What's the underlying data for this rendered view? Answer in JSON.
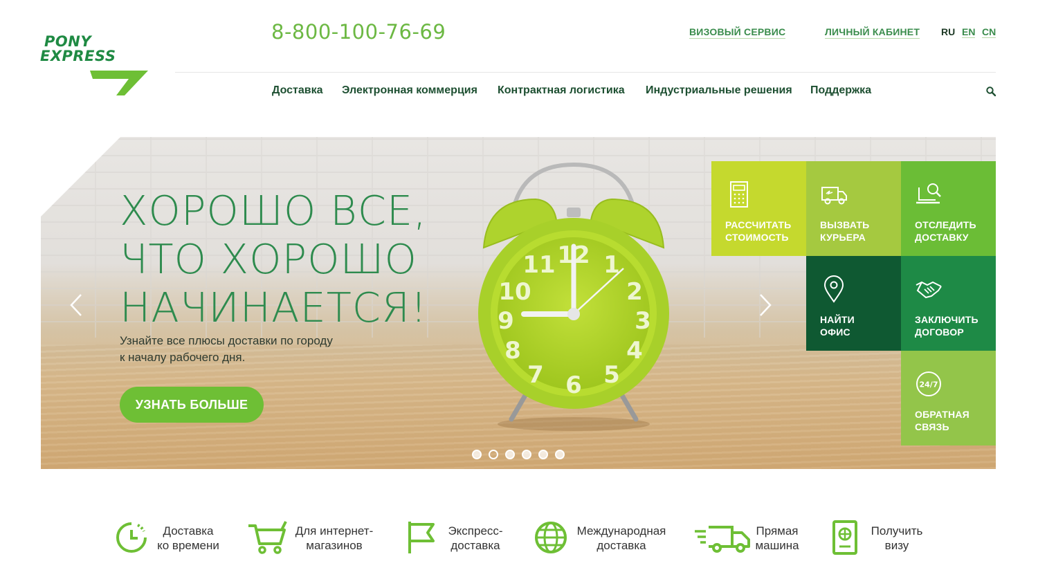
{
  "logo": {
    "line1": "PONY",
    "line2": "EXPRESS"
  },
  "header": {
    "phone": "8-800-100-76-69",
    "visa_service": "ВИЗОВЫЙ СЕРВИС",
    "personal_account": "ЛИЧНЫЙ КАБИНЕТ",
    "languages": [
      "RU",
      "EN",
      "CN"
    ],
    "active_language": "RU"
  },
  "nav": {
    "items": [
      "Доставка",
      "Электронная коммерция",
      "Контрактная логистика",
      "Индустриальные решения",
      "Поддержка"
    ]
  },
  "hero": {
    "title_lines": [
      "ХОРОШО ВСЕ,",
      "ЧТО ХОРОШО",
      "НАЧИНАЕТСЯ!"
    ],
    "subtitle_lines": [
      "Узнайте все плюсы доставки по городу",
      "к началу рабочего дня."
    ],
    "button": "УЗНАТЬ БОЛЬШЕ",
    "slide_count": 6,
    "active_slide": 2
  },
  "tiles": [
    {
      "line1": "РАССЧИТАТЬ",
      "line2": "СТОИМОСТЬ",
      "icon": "calculator-icon",
      "color": "#c5d92e"
    },
    {
      "line1": "ВЫЗВАТЬ",
      "line2": "КУРЬЕРА",
      "icon": "truck-icon",
      "color": "#a5c940"
    },
    {
      "line1": "ОТСЛЕДИТЬ",
      "line2": "ДОСТАВКУ",
      "icon": "laptop-search-icon",
      "color": "#6bbd36"
    },
    {
      "line1": "НАЙТИ",
      "line2": "ОФИС",
      "icon": "location-pin-icon",
      "color": "#0f5932"
    },
    {
      "line1": "ЗАКЛЮЧИТЬ",
      "line2": "ДОГОВОР",
      "icon": "handshake-icon",
      "color": "#1e8a46"
    },
    {
      "line1": "ОБРАТНАЯ",
      "line2": "СВЯЗЬ",
      "icon": "support-24-7-icon",
      "color": "#93c54a"
    }
  ],
  "features": [
    {
      "line1": "Доставка",
      "line2": "ко времени",
      "icon": "clock-icon"
    },
    {
      "line1": "Для интернет-",
      "line2": "магазинов",
      "icon": "cart-icon"
    },
    {
      "line1": "Экспресс-",
      "line2": "доставка",
      "icon": "flag-icon"
    },
    {
      "line1": "Международная",
      "line2": "доставка",
      "icon": "globe-icon"
    },
    {
      "line1": "Прямая",
      "line2": "машина",
      "icon": "fast-truck-icon"
    },
    {
      "line1": "Получить",
      "line2": "визу",
      "icon": "passport-icon"
    }
  ],
  "colors": {
    "brand_green": "#6ebf35",
    "dark_green": "#1d4f31"
  }
}
